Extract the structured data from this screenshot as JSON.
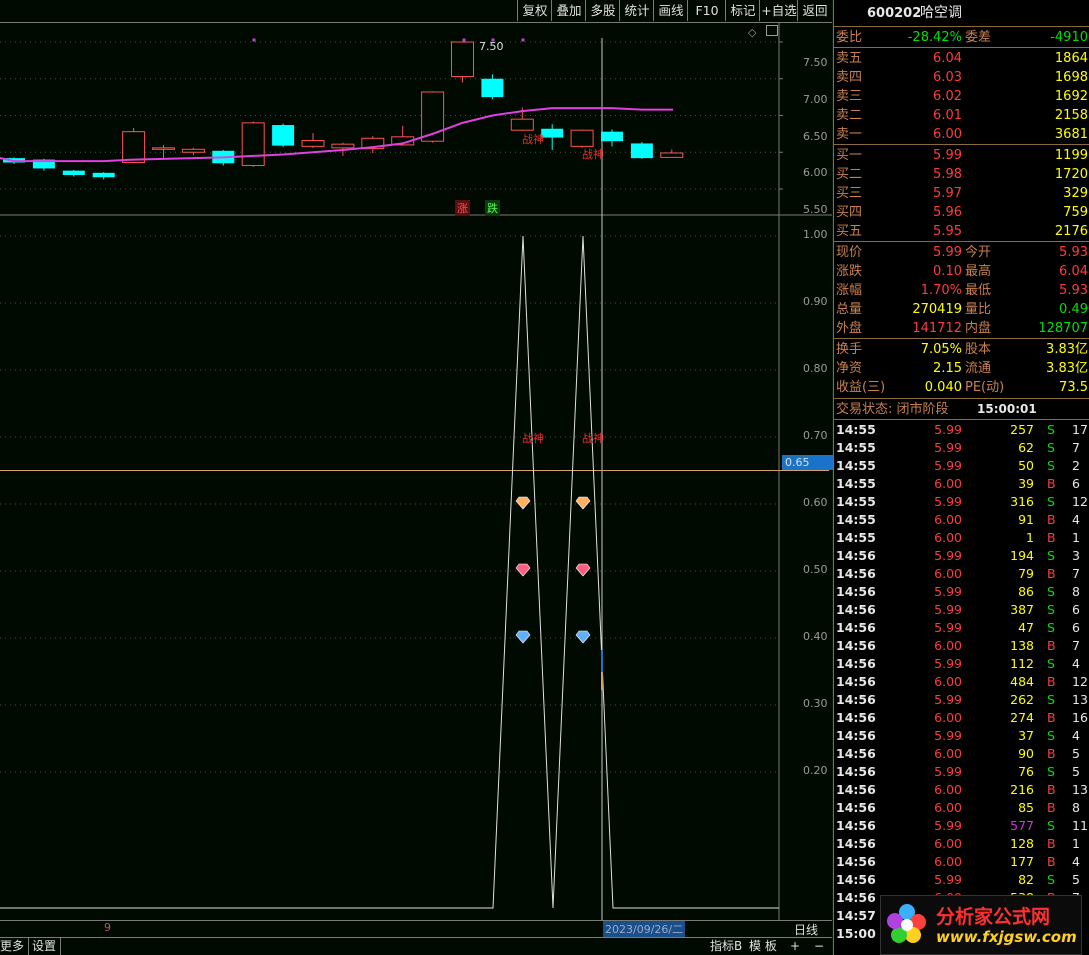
{
  "toolbar": {
    "buttons": [
      "复权",
      "叠加",
      "多股",
      "统计",
      "画线",
      "F10",
      "标记",
      "+自选",
      "返回"
    ]
  },
  "price_axis": [
    "7.50",
    "7.00",
    "6.50",
    "6.00",
    "5.50"
  ],
  "indicator_axis": [
    "1.00",
    "0.90",
    "0.80",
    "0.70",
    "0.60",
    "0.50",
    "0.40",
    "0.30",
    "0.20"
  ],
  "crosshair_value": "0.65",
  "annotations": {
    "high_price": "7.50",
    "zhangshen": "战神",
    "zhang": "涨",
    "die": "跌"
  },
  "bottom": {
    "date_label": "2023/09/26/二",
    "period": "日线",
    "left_marker": "9",
    "more": "更多",
    "settings": "设置",
    "indicator_b": "指标B",
    "template": "模 板",
    "plus": "+",
    "minus": "−"
  },
  "stock": {
    "code": "600202",
    "name": "哈空调"
  },
  "weibi": {
    "label1": "委比",
    "val1": "-28.42%",
    "label2": "委差",
    "val2": "-4910"
  },
  "asks": [
    {
      "label": "卖五",
      "price": "6.04",
      "vol": "1864"
    },
    {
      "label": "卖四",
      "price": "6.03",
      "vol": "1698"
    },
    {
      "label": "卖三",
      "price": "6.02",
      "vol": "1692"
    },
    {
      "label": "卖二",
      "price": "6.01",
      "vol": "2158"
    },
    {
      "label": "卖一",
      "price": "6.00",
      "vol": "3681"
    }
  ],
  "bids": [
    {
      "label": "买一",
      "price": "5.99",
      "vol": "1199"
    },
    {
      "label": "买二",
      "price": "5.98",
      "vol": "1720"
    },
    {
      "label": "买三",
      "price": "5.97",
      "vol": "329"
    },
    {
      "label": "买四",
      "price": "5.96",
      "vol": "759"
    },
    {
      "label": "买五",
      "price": "5.95",
      "vol": "2176"
    }
  ],
  "quote": [
    {
      "l1": "现价",
      "v1": "5.99",
      "l2": "今开",
      "v2": "5.93"
    },
    {
      "l1": "涨跌",
      "v1": "0.10",
      "l2": "最高",
      "v2": "6.04"
    },
    {
      "l1": "涨幅",
      "v1": "1.70%",
      "l2": "最低",
      "v2": "5.93"
    },
    {
      "l1": "总量",
      "v1": "270419",
      "l2": "量比",
      "v2": "0.49"
    },
    {
      "l1": "外盘",
      "v1": "141712",
      "l2": "内盘",
      "v2": "128707"
    }
  ],
  "fund": [
    {
      "l1": "换手",
      "v1": "7.05%",
      "l2": "股本",
      "v2": "3.83亿"
    },
    {
      "l1": "净资",
      "v1": "2.15",
      "l2": "流通",
      "v2": "3.83亿"
    },
    {
      "l1": "收益(三)",
      "v1": "0.040",
      "l2": "PE(动)",
      "v2": "73.5"
    }
  ],
  "trade_status": {
    "label": "交易状态: 闭市阶段",
    "time": "15:00:01"
  },
  "ticks": [
    [
      "14:55",
      "5.99",
      "257",
      "S",
      "17"
    ],
    [
      "14:55",
      "5.99",
      "62",
      "S",
      "7"
    ],
    [
      "14:55",
      "5.99",
      "50",
      "S",
      "2"
    ],
    [
      "14:55",
      "6.00",
      "39",
      "B",
      "6"
    ],
    [
      "14:55",
      "5.99",
      "316",
      "S",
      "12"
    ],
    [
      "14:55",
      "6.00",
      "91",
      "B",
      "4"
    ],
    [
      "14:55",
      "6.00",
      "1",
      "B",
      "1"
    ],
    [
      "14:56",
      "5.99",
      "194",
      "S",
      "3"
    ],
    [
      "14:56",
      "6.00",
      "79",
      "B",
      "7"
    ],
    [
      "14:56",
      "5.99",
      "86",
      "S",
      "8"
    ],
    [
      "14:56",
      "5.99",
      "387",
      "S",
      "6"
    ],
    [
      "14:56",
      "5.99",
      "47",
      "S",
      "6"
    ],
    [
      "14:56",
      "6.00",
      "138",
      "B",
      "7"
    ],
    [
      "14:56",
      "5.99",
      "112",
      "S",
      "4"
    ],
    [
      "14:56",
      "6.00",
      "484",
      "B",
      "12"
    ],
    [
      "14:56",
      "5.99",
      "262",
      "S",
      "13"
    ],
    [
      "14:56",
      "6.00",
      "274",
      "B",
      "16"
    ],
    [
      "14:56",
      "5.99",
      "37",
      "S",
      "4"
    ],
    [
      "14:56",
      "6.00",
      "90",
      "B",
      "5"
    ],
    [
      "14:56",
      "5.99",
      "76",
      "S",
      "5"
    ],
    [
      "14:56",
      "6.00",
      "216",
      "B",
      "13"
    ],
    [
      "14:56",
      "6.00",
      "85",
      "B",
      "8"
    ],
    [
      "14:56",
      "5.99",
      "577",
      "S",
      "11"
    ],
    [
      "14:56",
      "6.00",
      "128",
      "B",
      "1"
    ],
    [
      "14:56",
      "6.00",
      "177",
      "B",
      "4"
    ],
    [
      "14:56",
      "5.99",
      "82",
      "S",
      "5"
    ],
    [
      "14:56",
      "6.00",
      "538",
      "B",
      "7"
    ],
    [
      "14:57",
      "6.00",
      "3",
      "B",
      "1"
    ],
    [
      "15:00",
      "6.00",
      "45",
      "B",
      "3"
    ]
  ],
  "watermark": {
    "title": "分析家公式网",
    "url": "www.fxjgsw.com"
  },
  "chart_data": {
    "type": "candlestick",
    "candles": [
      {
        "o": 5.92,
        "c": 5.86,
        "h": 5.93,
        "l": 5.84
      },
      {
        "o": 5.9,
        "c": 5.78,
        "h": 5.91,
        "l": 5.75
      },
      {
        "o": 5.75,
        "c": 5.69,
        "h": 5.76,
        "l": 5.67
      },
      {
        "o": 5.72,
        "c": 5.66,
        "h": 5.73,
        "l": 5.63
      },
      {
        "o": 5.86,
        "c": 6.28,
        "h": 6.33,
        "l": 5.85
      },
      {
        "o": 6.06,
        "c": 6.06,
        "h": 6.1,
        "l": 5.92
      },
      {
        "o": 6.0,
        "c": 6.04,
        "h": 6.06,
        "l": 5.96
      },
      {
        "o": 6.02,
        "c": 5.85,
        "h": 6.03,
        "l": 5.82
      },
      {
        "o": 5.82,
        "c": 6.4,
        "h": 6.42,
        "l": 5.8
      },
      {
        "o": 6.37,
        "c": 6.09,
        "h": 6.39,
        "l": 6.07
      },
      {
        "o": 6.08,
        "c": 6.16,
        "h": 6.26,
        "l": 6.06
      },
      {
        "o": 6.06,
        "c": 6.11,
        "h": 6.13,
        "l": 5.95
      },
      {
        "o": 6.05,
        "c": 6.19,
        "h": 6.22,
        "l": 5.99
      },
      {
        "o": 6.1,
        "c": 6.21,
        "h": 6.36,
        "l": 6.09
      },
      {
        "o": 6.15,
        "c": 6.82,
        "h": 6.83,
        "l": 6.13
      },
      {
        "o": 7.03,
        "c": 7.5,
        "h": 7.5,
        "l": 6.95
      },
      {
        "o": 7.0,
        "c": 6.75,
        "h": 7.06,
        "l": 6.72
      },
      {
        "o": 6.3,
        "c": 6.45,
        "h": 6.61,
        "l": 6.29
      },
      {
        "o": 6.32,
        "c": 6.2,
        "h": 6.38,
        "l": 6.03
      },
      {
        "o": 6.08,
        "c": 6.3,
        "h": 6.31,
        "l": 6.06
      },
      {
        "o": 6.28,
        "c": 6.15,
        "h": 6.31,
        "l": 6.08
      },
      {
        "o": 6.12,
        "c": 5.92,
        "h": 6.14,
        "l": 5.91
      },
      {
        "o": 5.93,
        "c": 5.99,
        "h": 6.04,
        "l": 5.93
      }
    ],
    "ma": [
      5.88,
      5.88,
      5.88,
      5.88,
      5.9,
      5.91,
      5.92,
      5.93,
      5.95,
      5.97,
      6.0,
      6.03,
      6.07,
      6.12,
      6.25,
      6.4,
      6.5,
      6.56,
      6.6,
      6.6,
      6.6,
      6.58,
      6.58
    ],
    "indicator": [
      0,
      0,
      0,
      0,
      0,
      0,
      0,
      0,
      0,
      0,
      0,
      0,
      0,
      0,
      0,
      0,
      0,
      1,
      0,
      1,
      0,
      0,
      0
    ]
  }
}
